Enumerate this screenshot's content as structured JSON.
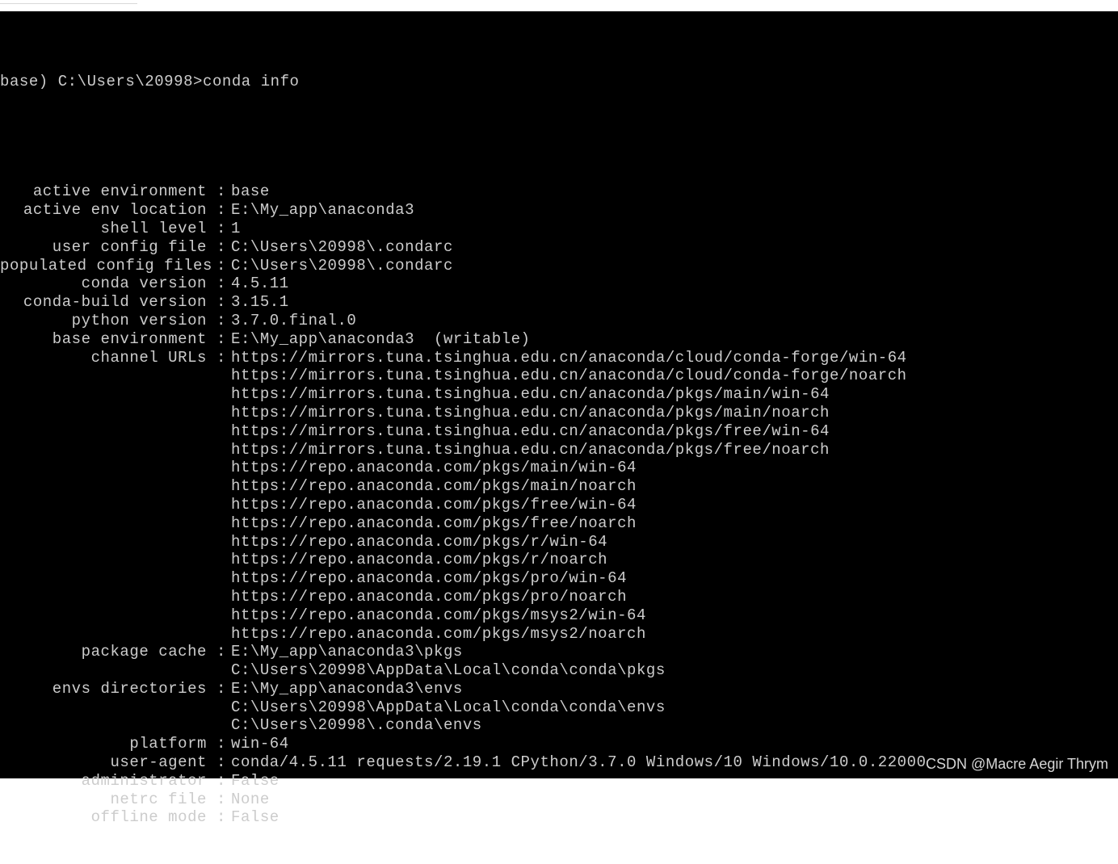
{
  "prompt": "base) C:\\Users\\20998>conda info",
  "separator": " : ",
  "entries": [
    {
      "key": "active environment",
      "values": [
        "base"
      ]
    },
    {
      "key": "active env location",
      "values": [
        "E:\\My_app\\anaconda3"
      ]
    },
    {
      "key": "shell level",
      "values": [
        "1"
      ]
    },
    {
      "key": "user config file",
      "values": [
        "C:\\Users\\20998\\.condarc"
      ]
    },
    {
      "key": "populated config files",
      "values": [
        "C:\\Users\\20998\\.condarc"
      ]
    },
    {
      "key": "conda version",
      "values": [
        "4.5.11"
      ]
    },
    {
      "key": "conda-build version",
      "values": [
        "3.15.1"
      ]
    },
    {
      "key": "python version",
      "values": [
        "3.7.0.final.0"
      ]
    },
    {
      "key": "base environment",
      "values": [
        "E:\\My_app\\anaconda3  (writable)"
      ]
    },
    {
      "key": "channel URLs",
      "values": [
        "https://mirrors.tuna.tsinghua.edu.cn/anaconda/cloud/conda-forge/win-64",
        "https://mirrors.tuna.tsinghua.edu.cn/anaconda/cloud/conda-forge/noarch",
        "https://mirrors.tuna.tsinghua.edu.cn/anaconda/pkgs/main/win-64",
        "https://mirrors.tuna.tsinghua.edu.cn/anaconda/pkgs/main/noarch",
        "https://mirrors.tuna.tsinghua.edu.cn/anaconda/pkgs/free/win-64",
        "https://mirrors.tuna.tsinghua.edu.cn/anaconda/pkgs/free/noarch",
        "https://repo.anaconda.com/pkgs/main/win-64",
        "https://repo.anaconda.com/pkgs/main/noarch",
        "https://repo.anaconda.com/pkgs/free/win-64",
        "https://repo.anaconda.com/pkgs/free/noarch",
        "https://repo.anaconda.com/pkgs/r/win-64",
        "https://repo.anaconda.com/pkgs/r/noarch",
        "https://repo.anaconda.com/pkgs/pro/win-64",
        "https://repo.anaconda.com/pkgs/pro/noarch",
        "https://repo.anaconda.com/pkgs/msys2/win-64",
        "https://repo.anaconda.com/pkgs/msys2/noarch"
      ]
    },
    {
      "key": "package cache",
      "values": [
        "E:\\My_app\\anaconda3\\pkgs",
        "C:\\Users\\20998\\AppData\\Local\\conda\\conda\\pkgs"
      ]
    },
    {
      "key": "envs directories",
      "values": [
        "E:\\My_app\\anaconda3\\envs",
        "C:\\Users\\20998\\AppData\\Local\\conda\\conda\\envs",
        "C:\\Users\\20998\\.conda\\envs"
      ]
    },
    {
      "key": "platform",
      "values": [
        "win-64"
      ]
    },
    {
      "key": "user-agent",
      "values": [
        "conda/4.5.11 requests/2.19.1 CPython/3.7.0 Windows/10 Windows/10.0.22000"
      ]
    },
    {
      "key": "administrator",
      "values": [
        "False"
      ]
    },
    {
      "key": "netrc file",
      "values": [
        "None"
      ]
    },
    {
      "key": "offline mode",
      "values": [
        "False"
      ]
    }
  ],
  "watermark": "CSDN @Macre Aegir Thrym"
}
